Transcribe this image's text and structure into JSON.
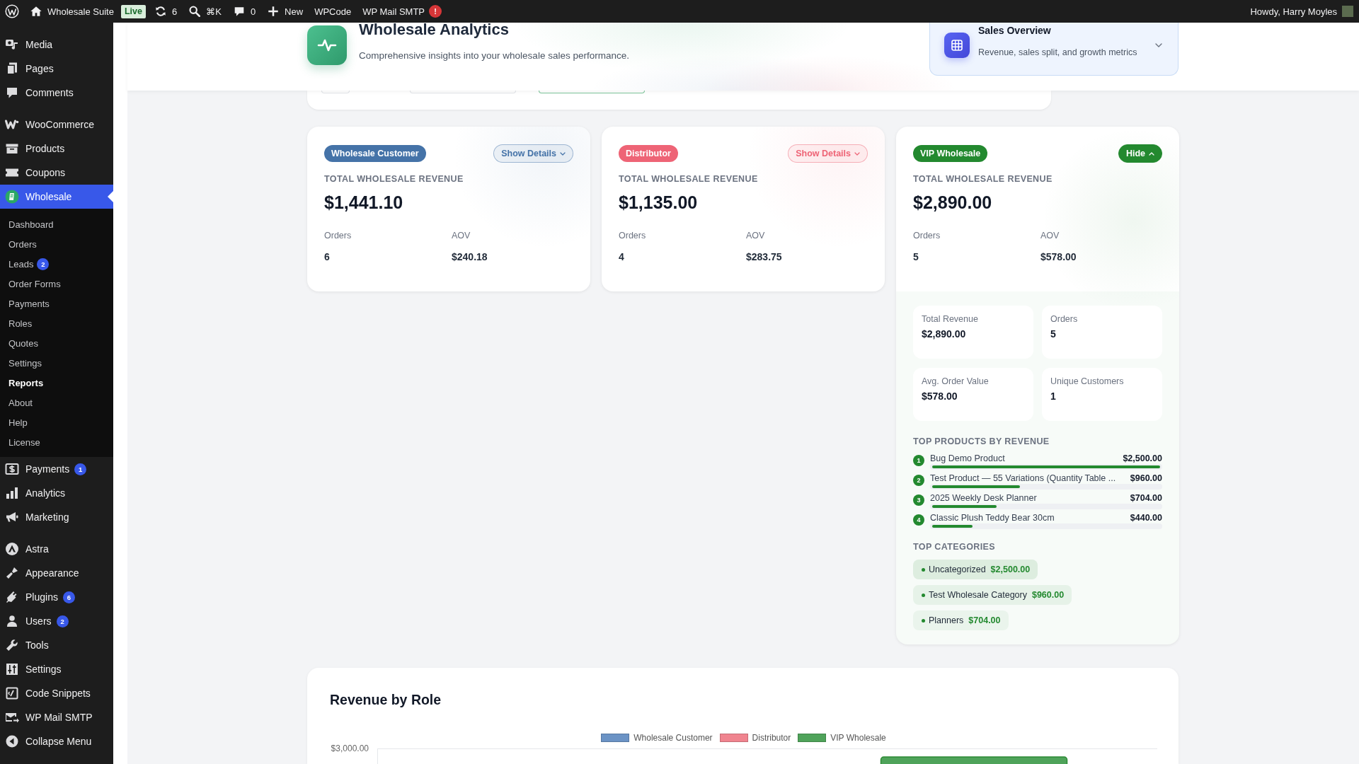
{
  "admin_bar": {
    "site_name": "Wholesale Suite",
    "status_badge": "Live",
    "updates_count": "6",
    "search_shortcut": "⌘K",
    "comments_count": "0",
    "new_label": "New",
    "links": [
      {
        "label": "WPCode"
      },
      {
        "label": "WP Mail SMTP",
        "alert": "!"
      }
    ],
    "greeting": "Howdy, Harry Moyles"
  },
  "sidebar": {
    "groups": [
      {
        "items": [
          {
            "label": "Media",
            "selected": false
          },
          {
            "label": "Pages",
            "selected": false
          },
          {
            "label": "Comments",
            "selected": false
          }
        ]
      },
      {
        "items": [
          {
            "label": "WooCommerce",
            "selected": false
          },
          {
            "label": "Products",
            "selected": false
          },
          {
            "label": "Coupons",
            "selected": false
          },
          {
            "label": "Wholesale",
            "selected": true,
            "children": [
              {
                "label": "Dashboard",
                "selected": false
              },
              {
                "label": "Orders",
                "selected": false
              },
              {
                "label": "Leads",
                "selected": false,
                "badge": "2"
              },
              {
                "label": "Order Forms",
                "selected": false
              },
              {
                "label": "Payments",
                "selected": false
              },
              {
                "label": "Roles",
                "selected": false
              },
              {
                "label": "Quotes",
                "selected": false
              },
              {
                "label": "Settings",
                "selected": false
              },
              {
                "label": "Reports",
                "selected": true
              },
              {
                "label": "About",
                "selected": false
              },
              {
                "label": "Help",
                "selected": false
              },
              {
                "label": "License",
                "selected": false
              }
            ]
          },
          {
            "label": "Payments",
            "selected": false,
            "badge": "1"
          },
          {
            "label": "Analytics",
            "selected": false
          },
          {
            "label": "Marketing",
            "selected": false
          }
        ]
      },
      {
        "items": [
          {
            "label": "Astra",
            "selected": false
          },
          {
            "label": "Appearance",
            "selected": false
          },
          {
            "label": "Plugins",
            "selected": false,
            "badge": "6"
          },
          {
            "label": "Users",
            "selected": false,
            "badge": "2"
          },
          {
            "label": "Tools",
            "selected": false
          },
          {
            "label": "Settings",
            "selected": false
          },
          {
            "label": "Code Snippets",
            "selected": false
          },
          {
            "label": "WP Mail SMTP",
            "selected": false
          },
          {
            "label": "Collapse Menu",
            "selected": false
          }
        ]
      }
    ]
  },
  "header": {
    "title": "Wholesale Analytics",
    "subtitle": "Comprehensive insights into your wholesale sales performance.",
    "section_picker": {
      "title": "Sales Overview",
      "subtitle": "Revenue, sales split, and growth metrics",
      "expanded": false
    }
  },
  "role_cards": [
    {
      "role": "Wholesale Customer",
      "color": "#4573a8",
      "toggle_label": "Show Details",
      "expanded": false,
      "metric_label": "TOTAL WHOLESALE REVENUE",
      "revenue": "$1,441.10",
      "stats": [
        {
          "label": "Orders",
          "value": "6"
        },
        {
          "label": "AOV",
          "value": "$240.18"
        }
      ]
    },
    {
      "role": "Distributor",
      "color": "#ee6476",
      "toggle_label": "Show Details",
      "expanded": false,
      "metric_label": "TOTAL WHOLESALE REVENUE",
      "revenue": "$1,135.00",
      "stats": [
        {
          "label": "Orders",
          "value": "4"
        },
        {
          "label": "AOV",
          "value": "$283.75"
        }
      ]
    },
    {
      "role": "VIP Wholesale",
      "color": "#23892f",
      "toggle_label": "Hide",
      "expanded": true,
      "metric_label": "TOTAL WHOLESALE REVENUE",
      "revenue": "$2,890.00",
      "stats": [
        {
          "label": "Orders",
          "value": "5"
        },
        {
          "label": "AOV",
          "value": "$578.00"
        }
      ],
      "details": {
        "summary": [
          {
            "label": "Total Revenue",
            "value": "$2,890.00"
          },
          {
            "label": "Orders",
            "value": "5"
          },
          {
            "label": "Avg. Order Value",
            "value": "$578.00"
          },
          {
            "label": "Unique Customers",
            "value": "1"
          }
        ],
        "products_heading": "TOP PRODUCTS BY REVENUE",
        "products": [
          {
            "rank": "1",
            "name": "Bug Demo Product",
            "amount": "$2,500.00",
            "level": 1.0
          },
          {
            "rank": "2",
            "name": "Test Product — 55 Variations (Quantity Table ...",
            "amount": "$960.00",
            "level": 0.384
          },
          {
            "rank": "3",
            "name": "2025 Weekly Desk Planner",
            "amount": "$704.00",
            "level": 0.2816
          },
          {
            "rank": "4",
            "name": "Classic Plush Teddy Bear 30cm",
            "amount": "$440.00",
            "level": 0.176
          }
        ],
        "categories_heading": "TOP CATEGORIES",
        "categories": [
          {
            "name": "Uncategorized",
            "amount": "$2,500.00"
          },
          {
            "name": "Test Wholesale Category",
            "amount": "$960.00"
          },
          {
            "name": "Planners",
            "amount": "$704.00"
          }
        ]
      }
    }
  ],
  "chart": {
    "title": "Revenue by Role",
    "legend": [
      {
        "label": "Wholesale Customer",
        "color": "#6b93c5"
      },
      {
        "label": "Distributor",
        "color": "#f0848f"
      },
      {
        "label": "VIP Wholesale",
        "color": "#4fa35a"
      }
    ],
    "y_tick_label": "$3,000.00"
  }
}
